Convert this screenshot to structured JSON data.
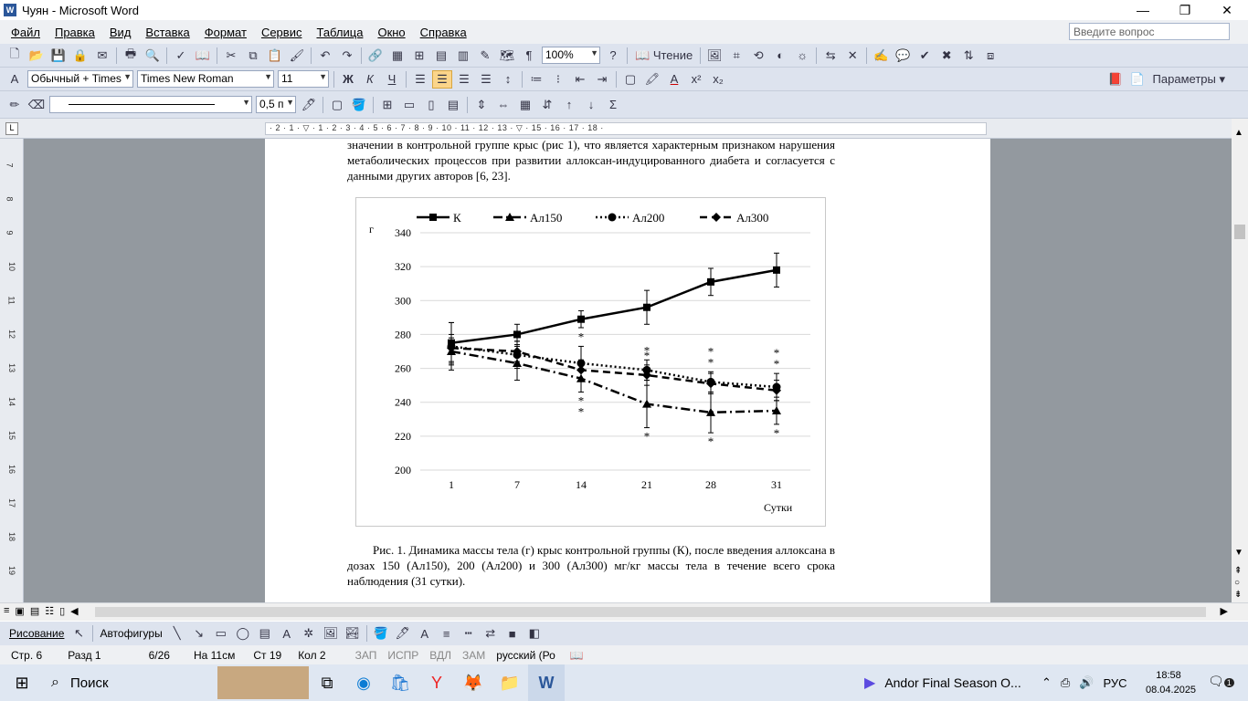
{
  "window": {
    "title": "Чуян - Microsoft Word",
    "app_icon": "W"
  },
  "menu": {
    "items": [
      "Файл",
      "Правка",
      "Вид",
      "Вставка",
      "Формат",
      "Сервис",
      "Таблица",
      "Окно",
      "Справка"
    ],
    "ask_placeholder": "Введите вопрос"
  },
  "toolbar1": {
    "zoom": "100%",
    "reading_label": "Чтение"
  },
  "toolbar2": {
    "style": "Обычный + Times",
    "font": "Times New Roman",
    "size": "11",
    "params_label": "Параметры"
  },
  "toolbar3": {
    "line_weight": "0,5 п"
  },
  "ruler": {
    "numbers": "· 2 · 1 · ▽ · 1 · 2 · 3 · 4 · 5 · 6 · 7 · 8 · 9 · 10 · 11 · 12 · 13 · ▽ · 15 · 16 · 17 · 18 ·"
  },
  "left_ruler": [
    "7",
    "8",
    "9",
    "10",
    "11",
    "12",
    "13",
    "14",
    "15",
    "16",
    "17",
    "18",
    "19"
  ],
  "document": {
    "para_top": "значении в контрольной группе крыс (рис 1), что является характерным признаком нарушения метаболических процессов при развитии аллоксан-индуцированного диабета и согласуется с данными других авторов [6, 23].",
    "caption": "Рис. 1. Динамика массы тела (г) крыс контрольной группы (К), после введения аллоксана в дозах 150 (Ал150), 200 (Ал200) и 300 (Ал300) мг/кг массы тела в течение всего срока наблюдения (31 сутки)."
  },
  "chart_data": {
    "type": "line",
    "ylabel": "г",
    "xlabel": "Сутки",
    "categories": [
      "1",
      "7",
      "14",
      "21",
      "28",
      "31"
    ],
    "ylim": [
      200,
      340
    ],
    "yticks": [
      200,
      220,
      240,
      260,
      280,
      300,
      320,
      340
    ],
    "grid": true,
    "legend_position": "top",
    "series": [
      {
        "name": "К",
        "values": [
          275,
          280,
          289,
          296,
          311,
          318
        ],
        "errors": [
          12,
          6,
          5,
          10,
          8,
          10
        ],
        "marker": "square",
        "dash": "solid",
        "stars": [
          "",
          "",
          "",
          "",
          "",
          ""
        ]
      },
      {
        "name": "Ал150",
        "values": [
          270,
          263,
          254,
          239,
          234,
          235
        ],
        "errors": [
          8,
          10,
          8,
          14,
          12,
          8
        ],
        "marker": "triangle",
        "dash": "dashdot",
        "stars": [
          "",
          "",
          "**",
          "*",
          "*",
          "*"
        ]
      },
      {
        "name": "Ал200",
        "values": [
          273,
          268,
          263,
          259,
          252,
          249
        ],
        "errors": [
          14,
          8,
          10,
          6,
          6,
          8
        ],
        "marker": "circle",
        "dash": "dotted",
        "stars": [
          "",
          "",
          "*",
          "*",
          "**",
          "**"
        ]
      },
      {
        "name": "Ал300",
        "values": [
          272,
          270,
          259,
          256,
          251,
          247
        ],
        "errors": [
          8,
          6,
          6,
          6,
          6,
          6
        ],
        "marker": "diamond",
        "dash": "dashed",
        "stars": [
          "",
          "",
          "",
          "*",
          "",
          ""
        ]
      }
    ]
  },
  "drawbar": {
    "draw_label": "Рисование",
    "autoshapes_label": "Автофигуры"
  },
  "status": {
    "page": "Стр. 6",
    "section": "Разд 1",
    "pages": "6/26",
    "at": "На 11см",
    "line": "Ст 19",
    "col": "Кол 2",
    "rec": "ЗАП",
    "trk": "ИСПР",
    "ext": "ВДЛ",
    "ovr": "ЗАМ",
    "lang": "русский (Ро"
  },
  "taskbar": {
    "search": "Поиск",
    "app_title": "Andor Final Season O...",
    "lang": "РУС",
    "time": "18:58",
    "date": "08.04.2025",
    "notif": "1"
  }
}
